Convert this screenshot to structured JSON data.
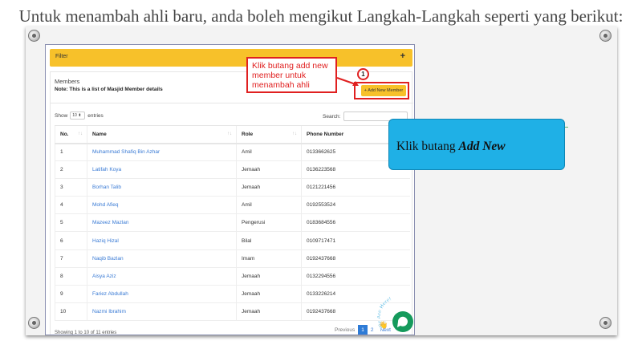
{
  "slide": {
    "title": "Untuk menambah ahli baru, anda boleh mengikut Langkah-Langkah seperti yang berikut:"
  },
  "app": {
    "filter_label": "Filter",
    "filter_toggle": "+",
    "members_title": "Members",
    "members_note": "Note: This is a list of Masjid Member details",
    "add_button": "+ Add New Member",
    "show_label": "Show",
    "entries_value": "10",
    "entries_label": "entries",
    "search_label": "Search:",
    "search_value": "",
    "columns": [
      "No.",
      "Name",
      "Role",
      "Phone Number"
    ],
    "rows": [
      {
        "no": "1",
        "name": "Muhammad Shafiq Bin Azhar",
        "role": "Amil",
        "phone": "0133662625"
      },
      {
        "no": "2",
        "name": "Latifah Koya",
        "role": "Jemaah",
        "phone": "0136223568"
      },
      {
        "no": "3",
        "name": "Borhan Talib",
        "role": "Jemaah",
        "phone": "0121221456"
      },
      {
        "no": "4",
        "name": "Mohd Afieq",
        "role": "Amil",
        "phone": "0192553524"
      },
      {
        "no": "5",
        "name": "Mazeez Mazlan",
        "role": "Pengerusi",
        "phone": "0183684556"
      },
      {
        "no": "6",
        "name": "Haziq Hizal",
        "role": "Bilal",
        "phone": "0109717471"
      },
      {
        "no": "7",
        "name": "Naqib Bazlan",
        "role": "Imam",
        "phone": "0192437668"
      },
      {
        "no": "8",
        "name": "Aisya Aziz",
        "role": "Jemaah",
        "phone": "0132294556"
      },
      {
        "no": "9",
        "name": "Fariez Abdullah",
        "role": "Jemaah",
        "phone": "0133226214"
      },
      {
        "no": "10",
        "name": "Nazmi Ibrahim",
        "role": "Jemaah",
        "phone": "0192437668"
      }
    ],
    "showing_text": "Showing 1 to 10 of 11 entries",
    "pager": {
      "previous": "Previous",
      "page1": "1",
      "page2": "2",
      "next": "Next"
    },
    "chat_badge": "We Are Here!"
  },
  "annotations": {
    "callout_text": "Klik butang add new member untuk menambah ahli",
    "step_number": "1",
    "info_prefix": "Klik butang ",
    "info_bold": "Add New",
    "highlight_color": "#e02020",
    "info_box_color": "#1fb0e6"
  }
}
